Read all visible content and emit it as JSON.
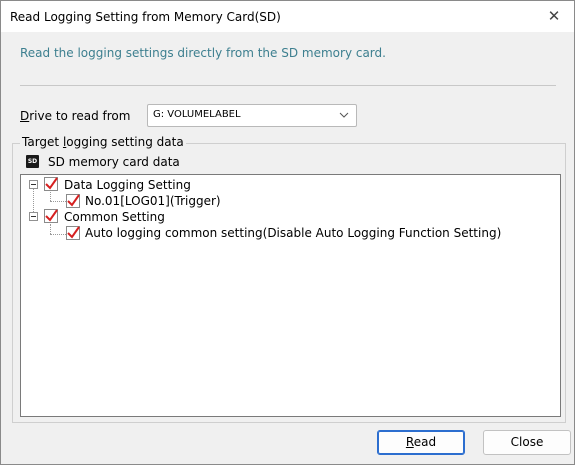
{
  "window": {
    "title": "Read Logging Setting from Memory Card(SD)",
    "close_glyph": "✕"
  },
  "description": "Read the logging settings directly from the SD memory card.",
  "drive": {
    "label_prefix": "",
    "label_mnemonic": "D",
    "label_rest": "rive to read from",
    "selected_value": "G:  VOLUMELABEL"
  },
  "target_group": {
    "label_before": "Target ",
    "label_mnemonic": "l",
    "label_after": "ogging setting data",
    "sd_icon_text": "SD",
    "sd_label": "SD memory card data"
  },
  "tree": {
    "nodes": [
      {
        "label": "Data Logging Setting",
        "checked": true,
        "expanded": true
      },
      {
        "label": "No.01[LOG01](Trigger)",
        "checked": true
      },
      {
        "label": "Common Setting",
        "checked": true,
        "expanded": true
      },
      {
        "label": "Auto logging common setting(Disable Auto Logging Function Setting)",
        "checked": true
      }
    ]
  },
  "buttons": {
    "read_mnemonic": "R",
    "read_rest": "ead",
    "close": "Close"
  },
  "colors": {
    "description_text": "#3d7f8f",
    "check_red": "#d62020",
    "default_button_border": "#2c6ecf"
  }
}
